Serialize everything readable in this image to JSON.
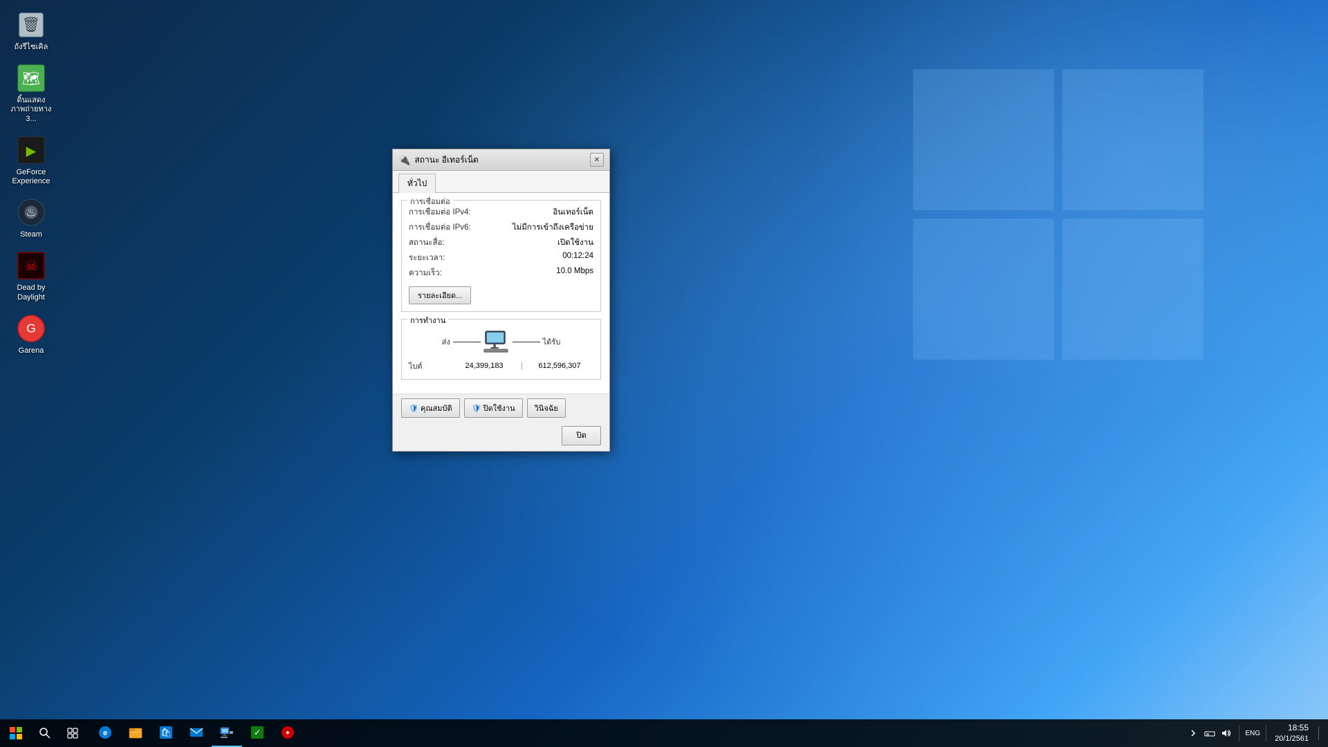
{
  "desktop": {
    "background": "windows10-blue"
  },
  "icons": [
    {
      "id": "recycle",
      "label": "ถังรีไซเคิล",
      "emoji": "🗑️"
    },
    {
      "id": "map3d",
      "label": "ดิ้นแสดงภาพถ่ายทาง 3...",
      "emoji": "🗺️"
    },
    {
      "id": "geforce",
      "label": "GeForce Experience",
      "emoji": "🎮"
    },
    {
      "id": "steam",
      "label": "Steam",
      "emoji": "🎮"
    },
    {
      "id": "deadbydaylight",
      "label": "Dead by Daylight",
      "emoji": "🎮"
    },
    {
      "id": "garena",
      "label": "Garena",
      "emoji": "🎮"
    }
  ],
  "dialog": {
    "title": "สถานะ อีเทอร์เน็ต",
    "tab_general": "ทั่วไป",
    "section_connection": "การเชื่อมต่อ",
    "ipv4_label": "การเชื่อมต่อ IPv4:",
    "ipv4_value": "อินเทอร์เน็ต",
    "ipv6_label": "การเชื่อมต่อ IPv6:",
    "ipv6_value": "ไม่มีการเข้าถึงเครือข่าย",
    "state_label": "สถานะสื่อ:",
    "state_value": "เปิดใช้งาน",
    "duration_label": "ระยะเวลา:",
    "duration_value": "00:12:24",
    "speed_label": "ความเร็ว:",
    "speed_value": "10.0 Mbps",
    "details_btn": "รายละเอียด...",
    "section_activity": "การทำงาน",
    "send_label": "ส่ง",
    "receive_label": "ได้รับ",
    "bytes_label": "ไบต์",
    "bytes_sent": "24,399,183",
    "bytes_recv": "612,596,307",
    "btn_properties": "คุณสมบัติ",
    "btn_disable": "ปิดใช้งาน",
    "btn_diagnose": "วินิจฉัย",
    "btn_close": "ปิด"
  },
  "taskbar": {
    "time": "18:55",
    "date": "20/1/2561",
    "lang": "ENG",
    "apps": [
      {
        "id": "edge",
        "emoji": "🌐",
        "active": false
      },
      {
        "id": "explorer",
        "emoji": "📁",
        "active": false
      },
      {
        "id": "store",
        "emoji": "🛍️",
        "active": false
      },
      {
        "id": "mail",
        "emoji": "✉️",
        "active": false
      },
      {
        "id": "network",
        "emoji": "🌐",
        "active": true
      },
      {
        "id": "greenapp",
        "emoji": "✔️",
        "active": false
      },
      {
        "id": "redapp",
        "emoji": "🔴",
        "active": false
      }
    ]
  }
}
